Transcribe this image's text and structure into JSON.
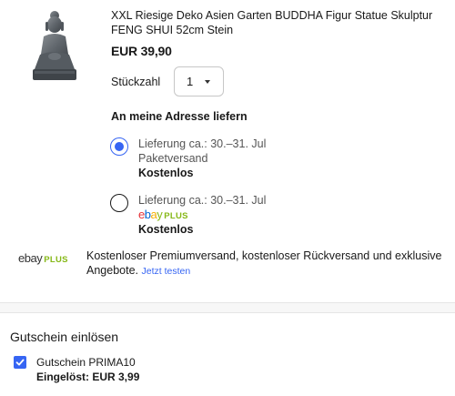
{
  "product": {
    "title": "XXL Riesige Deko Asien Garten BUDDHA Figur Statue Skulptur FENG SHUI 52cm Stein",
    "price": "EUR 39,90",
    "image_icon": "buddha-statue-image"
  },
  "quantity": {
    "label": "Stückzahl",
    "value": "1"
  },
  "shipping": {
    "heading": "An meine Adresse liefern",
    "options": [
      {
        "delivery": "Lieferung ca.: 30.–31. Jul",
        "method": "Paketversand",
        "cost": "Kostenlos",
        "selected": true
      },
      {
        "delivery": "Lieferung ca.: 30.–31. Jul",
        "method_logo": "ebay PLUS",
        "cost": "Kostenlos",
        "selected": false
      }
    ]
  },
  "ebay_plus": {
    "logo_ebay": "ebay",
    "logo_plus": "PLUS",
    "promo_text": "Kostenloser Premiumversand, kostenloser Rückversand und exklusive Angebote.",
    "link": "Jetzt testen"
  },
  "coupon": {
    "heading": "Gutschein einlösen",
    "name": "Gutschein PRIMA10",
    "applied": "Eingelöst: EUR 3,99",
    "checked": true
  },
  "colors": {
    "accent": "#3665f3",
    "ebay_plus_green": "#86b817"
  }
}
